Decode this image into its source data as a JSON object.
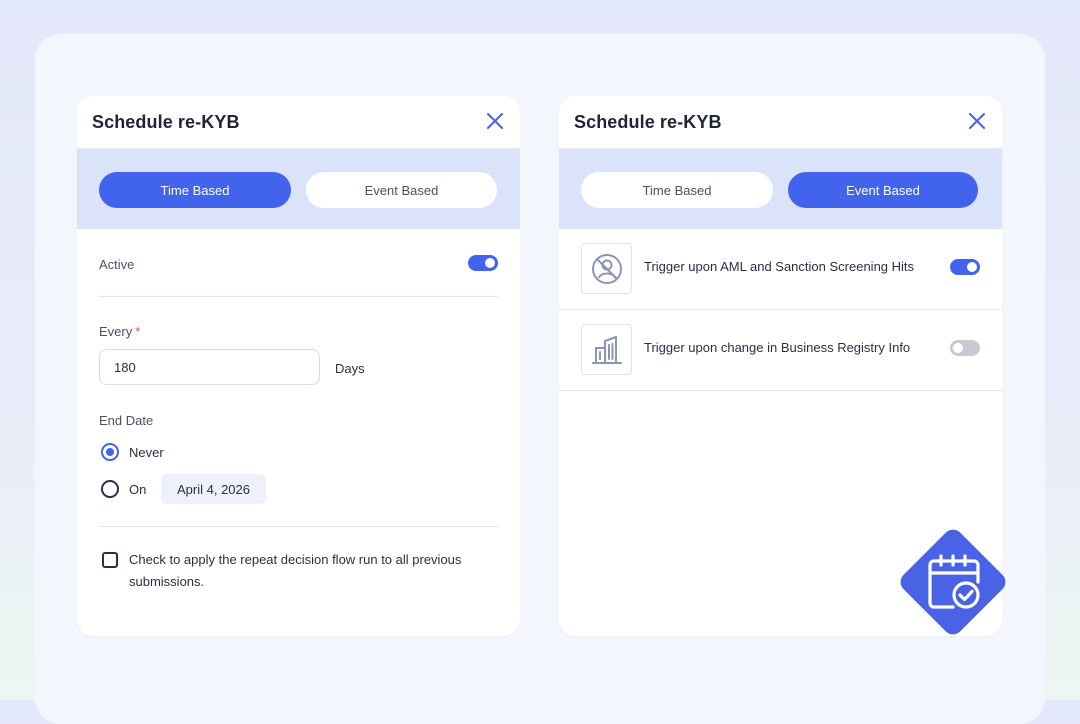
{
  "left_panel": {
    "title": "Schedule re-KYB",
    "tabs": {
      "time": "Time Based",
      "event": "Event Based"
    },
    "active_tab": "time",
    "active_label": "Active",
    "active_on": true,
    "every_label": "Every",
    "required_mark": "*",
    "every_value": "180",
    "every_unit": "Days",
    "end_date_label": "End Date",
    "end_options": {
      "never": "Never",
      "on": "On"
    },
    "end_selected": "never",
    "end_date_value": "April 4, 2026",
    "apply_checkbox_label": "Check to apply the repeat decision flow run to all previous submissions.",
    "apply_checked": false
  },
  "right_panel": {
    "title": "Schedule re-KYB",
    "tabs": {
      "time": "Time Based",
      "event": "Event Based"
    },
    "active_tab": "event",
    "triggers": [
      {
        "label": "Trigger upon AML and Sanction Screening Hits",
        "icon": "no-person-icon",
        "enabled": true
      },
      {
        "label": "Trigger upon change in Business Registry Info",
        "icon": "buildings-icon",
        "enabled": false
      }
    ]
  },
  "badge": {
    "icon": "calendar-check-icon"
  },
  "colors": {
    "accent": "#4263eb",
    "tab_band": "#dbe3fa",
    "icon_stroke": "#8e95b3",
    "toggle_off": "#c7cad3"
  }
}
